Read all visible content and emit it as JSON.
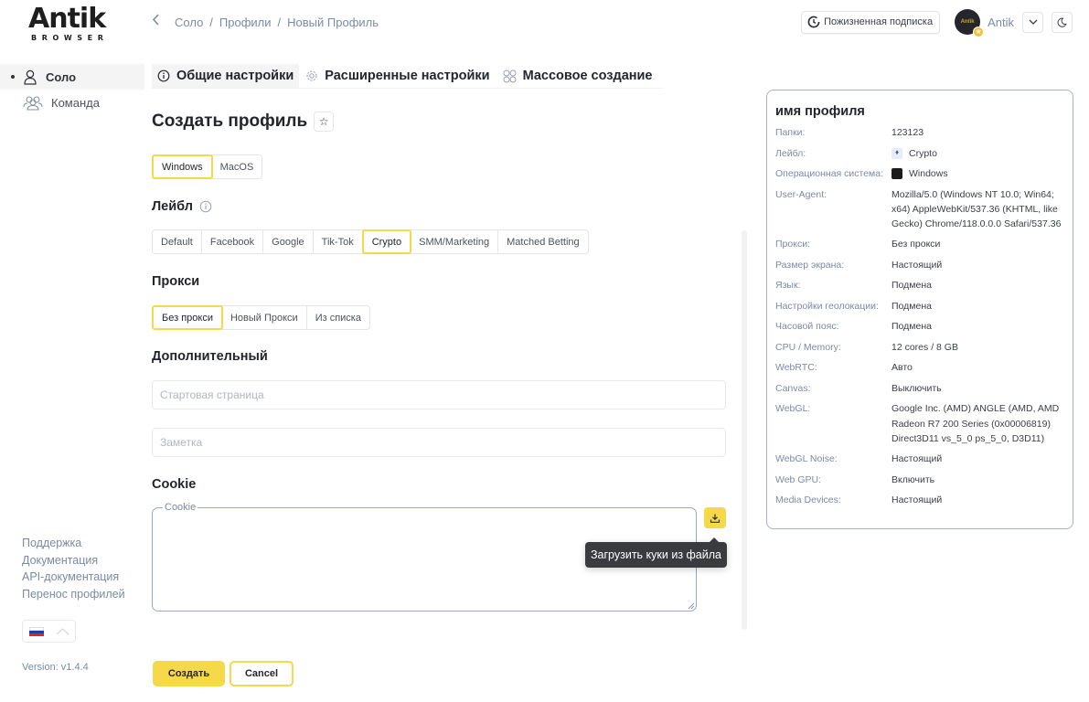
{
  "app": {
    "logo_main": "Antik",
    "logo_sub": "BROWSER",
    "version": "Version: v1.4.4"
  },
  "breadcrumb": {
    "back_icon": "chevron-left-icon",
    "items": [
      "Соло",
      "Профили",
      "Новый Профиль"
    ],
    "separator": "/"
  },
  "header": {
    "subscription_label": "Пожизненная подписка",
    "user_name": "Antik",
    "avatar_text": "Antik",
    "dropdown_icon": "chevron-down-icon",
    "theme_icon": "moon-icon"
  },
  "sidebar": {
    "items": [
      {
        "label": "Соло",
        "icon": "user-icon",
        "active": true
      },
      {
        "label": "Команда",
        "icon": "users-icon",
        "active": false
      }
    ],
    "links": [
      "Поддержка",
      "Документация",
      "API-документация",
      "Перенос профилей"
    ],
    "language": {
      "flag": "ru",
      "icon": "chevron-up-icon"
    }
  },
  "tabs": [
    {
      "label": "Общие настройки",
      "icon": "info-icon",
      "active": true
    },
    {
      "label": "Расширенные настройки",
      "icon": "gear-icon",
      "active": false
    },
    {
      "label": "Массовое создание",
      "icon": "grid-icon",
      "active": false
    }
  ],
  "form": {
    "title": "Создать профиль",
    "os_options": [
      "Windows",
      "MacOS"
    ],
    "os_selected": "Windows",
    "label_title": "Лейбл",
    "label_options": [
      "Default",
      "Facebook",
      "Google",
      "Tik-Tok",
      "Crypto",
      "SMM/Marketing",
      "Matched Betting"
    ],
    "label_selected": "Crypto",
    "proxy_title": "Прокси",
    "proxy_options": [
      "Без прокси",
      "Новый Прокси",
      "Из списка"
    ],
    "proxy_selected": "Без прокси",
    "additional_title": "Дополнительный",
    "start_page": {
      "value": "",
      "placeholder": "Стартовая страница"
    },
    "note": {
      "value": "",
      "placeholder": "Заметка"
    },
    "cookie_title": "Cookie",
    "cookie_legend": "Cookie",
    "cookie_value": "",
    "upload_tooltip": "Загрузить куки из файла",
    "create_label": "Создать",
    "cancel_label": "Cancel"
  },
  "summary": {
    "title": "имя профиля",
    "rows": [
      {
        "key": "Папки:",
        "value": "123123"
      },
      {
        "key": "Лейбл:",
        "value": "Crypto",
        "icon": "ethereum-icon"
      },
      {
        "key": "Операционная система:",
        "value": "Windows",
        "icon": "windows-icon"
      },
      {
        "key": "User-Agent:",
        "value": "Mozilla/5.0 (Windows NT 10.0; Win64; x64) AppleWebKit/537.36 (KHTML, like Gecko) Chrome/118.0.0.0 Safari/537.36"
      },
      {
        "key": "Прокси:",
        "value": "Без прокси"
      },
      {
        "key": "Размер экрана:",
        "value": "Настоящий"
      },
      {
        "key": "Язык:",
        "value": "Подмена"
      },
      {
        "key": "Настройки геолокации:",
        "value": "Подмена"
      },
      {
        "key": "Часовой пояс:",
        "value": "Подмена"
      },
      {
        "key": "CPU / Memory:",
        "value": "12 cores / 8 GB"
      },
      {
        "key": "WebRTC:",
        "value": "Авто"
      },
      {
        "key": "Canvas:",
        "value": "Выключить"
      },
      {
        "key": "WebGL:",
        "value": "Google Inc. (AMD) ANGLE (AMD, AMD Radeon R7 200 Series (0x00006819) Direct3D11 vs_5_0 ps_5_0, D3D11)"
      },
      {
        "key": "WebGL Noise:",
        "value": "Настоящий"
      },
      {
        "key": "Web GPU:",
        "value": "Включить"
      },
      {
        "key": "Media Devices:",
        "value": "Настоящий"
      }
    ]
  },
  "colors": {
    "accent": "#f5d948",
    "muted_text": "#7b8aa6",
    "tooltip_bg": "#3a3b3e",
    "panel_border": "#a7b1c6"
  }
}
